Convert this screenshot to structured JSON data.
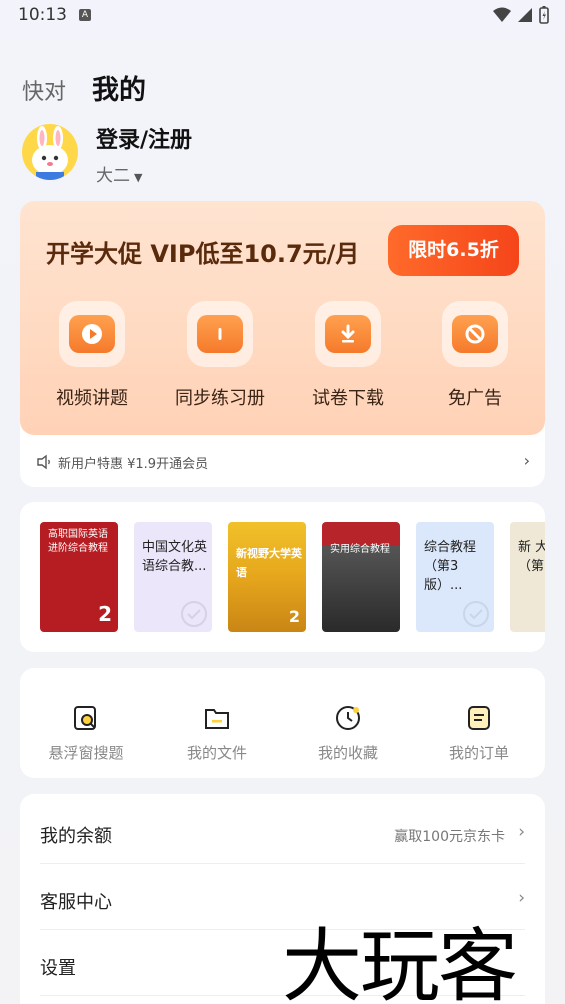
{
  "status_bar": {
    "time": "10:13",
    "notif": "A"
  },
  "tabs": {
    "inactive": "快对",
    "active": "我的"
  },
  "profile": {
    "login": "登录/注册",
    "grade": "大二"
  },
  "vip": {
    "title": "开学大促 VIP低至10.7元/月",
    "badge": "限时6.5折",
    "perks": [
      {
        "label": "视频讲题",
        "icon": "play-icon"
      },
      {
        "label": "同步练习册",
        "icon": "book-icon"
      },
      {
        "label": "试卷下载",
        "icon": "download-icon"
      },
      {
        "label": "免广告",
        "icon": "no-ads-icon"
      }
    ],
    "footer": "新用户特惠 ¥1.9开通会员"
  },
  "books": [
    {
      "title": "高职国际英语 进阶综合教程",
      "color": "#b51d22"
    },
    {
      "title": "中国文化英语综合教...",
      "color": "#ece6fb"
    },
    {
      "title": "新视野大学英语",
      "color": "#e8b023"
    },
    {
      "title": "实用综合教程",
      "color": "#333333"
    },
    {
      "title": "综合教程（第3版）...",
      "color": "#dbe8fb"
    },
    {
      "title": "新 大学 （第",
      "color": "#efe8d6"
    }
  ],
  "tools": [
    {
      "label": "悬浮窗搜题",
      "icon": "search-doc-icon"
    },
    {
      "label": "我的文件",
      "icon": "folder-icon"
    },
    {
      "label": "我的收藏",
      "icon": "clock-icon"
    },
    {
      "label": "我的订单",
      "icon": "order-icon"
    }
  ],
  "menu": [
    {
      "label": "我的余额",
      "extra": "赢取100元京东卡"
    },
    {
      "label": "客服中心",
      "extra": ""
    },
    {
      "label": "设置",
      "extra": ""
    }
  ],
  "watermark": "大玩客",
  "colors": {
    "accent": "#f5451a",
    "vip_bg": "#ffd9c0",
    "tool_yellow": "#ffd23b"
  }
}
